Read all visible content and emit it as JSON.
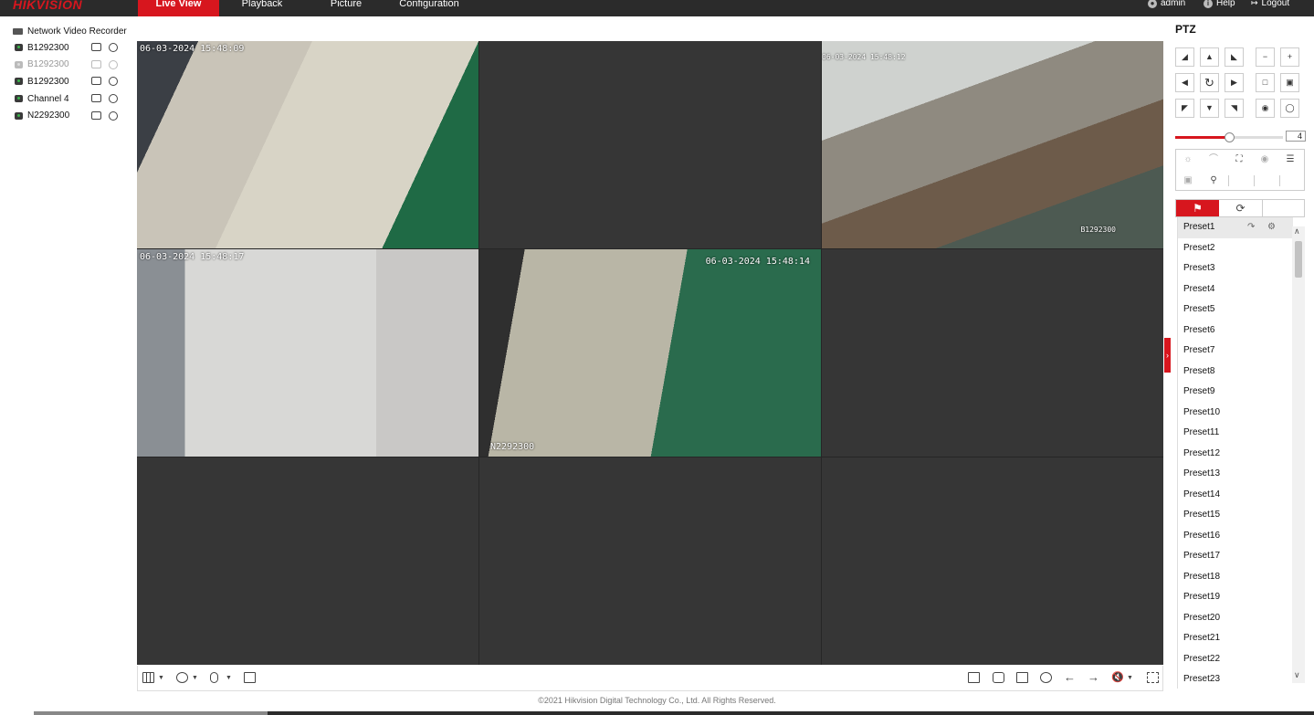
{
  "brand": {
    "logo": "HIKVISION",
    "accent": "#d7161e"
  },
  "nav": {
    "tabs": [
      {
        "label": "Live View",
        "active": true
      },
      {
        "label": "Playback",
        "active": false
      },
      {
        "label": "Picture",
        "active": false
      },
      {
        "label": "Configuration",
        "active": false
      }
    ],
    "user": "admin",
    "help": "Help",
    "logout": "Logout"
  },
  "tree": {
    "root": "Network Video Recorder",
    "channels": [
      {
        "label": "B1292300",
        "online": true
      },
      {
        "label": "B1292300",
        "online": false
      },
      {
        "label": "B1292300",
        "online": true
      },
      {
        "label": "Channel 4",
        "online": true
      },
      {
        "label": "N2292300",
        "online": true
      }
    ]
  },
  "grid": {
    "cells": [
      {
        "ts": "06-03-2024 15:48:09",
        "name": "",
        "active": true
      },
      {
        "ts": "",
        "name": "",
        "active": false
      },
      {
        "ts": "06-03-2024 15:48:12",
        "name": "B1292300",
        "active": true
      },
      {
        "ts": "06-03-2024 15:48:17",
        "name": "",
        "active": true
      },
      {
        "ts": "06-03-2024 15:48:14",
        "name": "N2292300",
        "active": true
      },
      {
        "ts": "",
        "name": "",
        "active": false
      },
      {
        "ts": "",
        "name": "",
        "active": false
      },
      {
        "ts": "",
        "name": "",
        "active": false
      },
      {
        "ts": "",
        "name": "",
        "active": false
      }
    ]
  },
  "ptz": {
    "title": "PTZ",
    "speed": 4,
    "speed_fraction": 0.5
  },
  "presets": [
    "Preset1",
    "Preset2",
    "Preset3",
    "Preset4",
    "Preset5",
    "Preset6",
    "Preset7",
    "Preset8",
    "Preset9",
    "Preset10",
    "Preset11",
    "Preset12",
    "Preset13",
    "Preset14",
    "Preset15",
    "Preset16",
    "Preset17",
    "Preset18",
    "Preset19",
    "Preset20",
    "Preset21",
    "Preset22",
    "Preset23"
  ],
  "footer": {
    "copyright": "©2021 Hikvision Digital Technology Co., Ltd. All Rights Reserved."
  }
}
